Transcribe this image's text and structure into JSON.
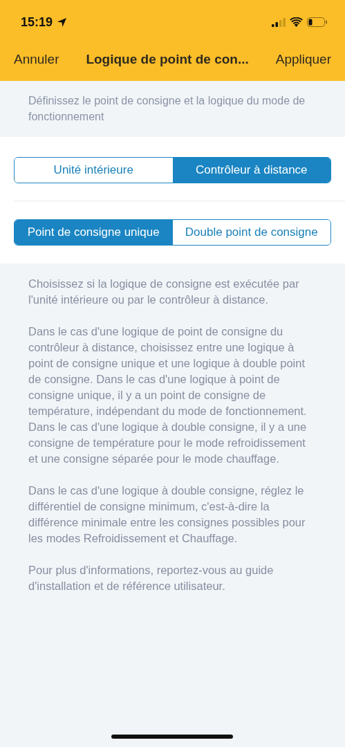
{
  "status_bar": {
    "time": "15:19"
  },
  "nav": {
    "cancel": "Annuler",
    "title": "Logique de point de con...",
    "apply": "Appliquer"
  },
  "subtitle": "Définissez le point de consigne et la logique du mode de fonctionnement",
  "segments": [
    [
      {
        "label": "Unité intérieure",
        "selected": false
      },
      {
        "label": "Contrôleur à distance",
        "selected": true
      }
    ],
    [
      {
        "label": "Point de consigne unique",
        "selected": true
      },
      {
        "label": "Double point de consigne",
        "selected": false
      }
    ]
  ],
  "help": [
    "Choisissez si la logique de consigne est exécutée par l'unité intérieure ou par le contrôleur à distance.",
    "Dans le cas d'une logique de point de consigne du contrôleur à distance, choisissez entre une logique à point de consigne unique et une logique à double point de consigne. Dans le cas d'une logique à point de consigne unique, il y a un point de consigne de température, indépendant du mode de fonctionnement. Dans le cas d'une logique à double consigne, il y a une consigne de température pour le mode refroidissement et une consigne séparée pour le mode chauffage.",
    "Dans le cas d'une logique à double consigne, réglez le différentiel de consigne minimum, c'est-à-dire la différence minimale entre les consignes possibles pour les modes Refroidissement et Chauffage.",
    "Pour plus d'informations, reportez-vous au guide d'installation et de référence utilisateur."
  ]
}
